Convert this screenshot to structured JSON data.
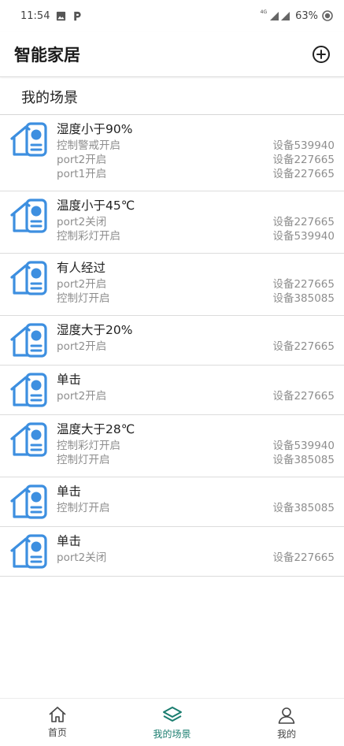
{
  "status_bar": {
    "time": "11:54",
    "network": "4G",
    "battery": "63%",
    "icons": [
      "image-icon",
      "parking-app-icon",
      "signal-icon",
      "battery-icon"
    ]
  },
  "header": {
    "title": "智能家居",
    "add_icon": "add-circle-icon"
  },
  "section": {
    "title": "我的场景"
  },
  "scenes": [
    {
      "title": "湿度小于90%",
      "actions": [
        {
          "name": "控制警戒开启",
          "device": "设备539940"
        },
        {
          "name": "port2开启",
          "device": "设备227665"
        },
        {
          "name": "port1开启",
          "device": "设备227665"
        }
      ]
    },
    {
      "title": "温度小于45℃",
      "actions": [
        {
          "name": "port2关闭",
          "device": "设备227665"
        },
        {
          "name": "控制彩灯开启",
          "device": "设备539940"
        }
      ]
    },
    {
      "title": "有人经过",
      "actions": [
        {
          "name": "port2开启",
          "device": "设备227665"
        },
        {
          "name": "控制灯开启",
          "device": "设备385085"
        }
      ]
    },
    {
      "title": "湿度大于20%",
      "actions": [
        {
          "name": "port2开启",
          "device": "设备227665"
        }
      ]
    },
    {
      "title": "单击",
      "actions": [
        {
          "name": "port2开启",
          "device": "设备227665"
        }
      ]
    },
    {
      "title": "温度大于28℃",
      "actions": [
        {
          "name": "控制彩灯开启",
          "device": "设备539940"
        },
        {
          "name": "控制灯开启",
          "device": "设备385085"
        }
      ]
    },
    {
      "title": "单击",
      "actions": [
        {
          "name": "控制灯开启",
          "device": "设备385085"
        }
      ]
    },
    {
      "title": "单击",
      "actions": [
        {
          "name": "port2关闭",
          "device": "设备227665"
        }
      ]
    }
  ],
  "bottom_nav": {
    "items": [
      {
        "label": "首页",
        "icon": "home-icon",
        "active": false
      },
      {
        "label": "我的场景",
        "icon": "layers-icon",
        "active": true
      },
      {
        "label": "我的",
        "icon": "user-icon",
        "active": false
      }
    ]
  },
  "colors": {
    "accent": "#1a7d6f",
    "scene_icon": "#3d8fe0",
    "secondary_text": "#8e8e8e"
  }
}
